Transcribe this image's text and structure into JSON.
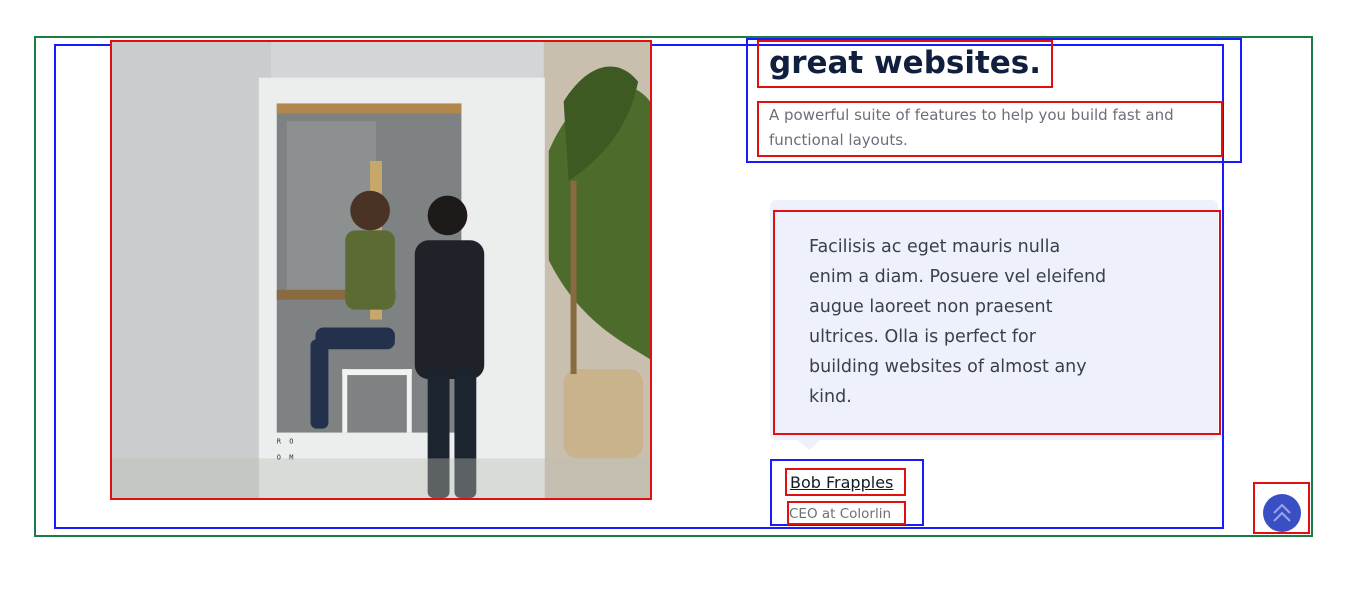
{
  "hero": {
    "heading": "great websites.",
    "subtext": "A powerful suite of features to help you build fast and functional layouts."
  },
  "testimonial": {
    "quote": "Facilisis ac eget mauris nulla enim a diam. Posuere vel eleifend augue laoreet non praesent ultrices. Olla is perfect for building websites of almost any kind.",
    "author_name": "Bob Frapples",
    "author_role": "CEO at Colorlin"
  },
  "photo": {
    "booth_mark": "R O\nO M"
  },
  "icons": {
    "scroll_top": "chevron-up-icon"
  },
  "colors": {
    "heading": "#0f1f3d",
    "quote_bg": "#eef0fc",
    "accent": "#3b4fc4"
  }
}
